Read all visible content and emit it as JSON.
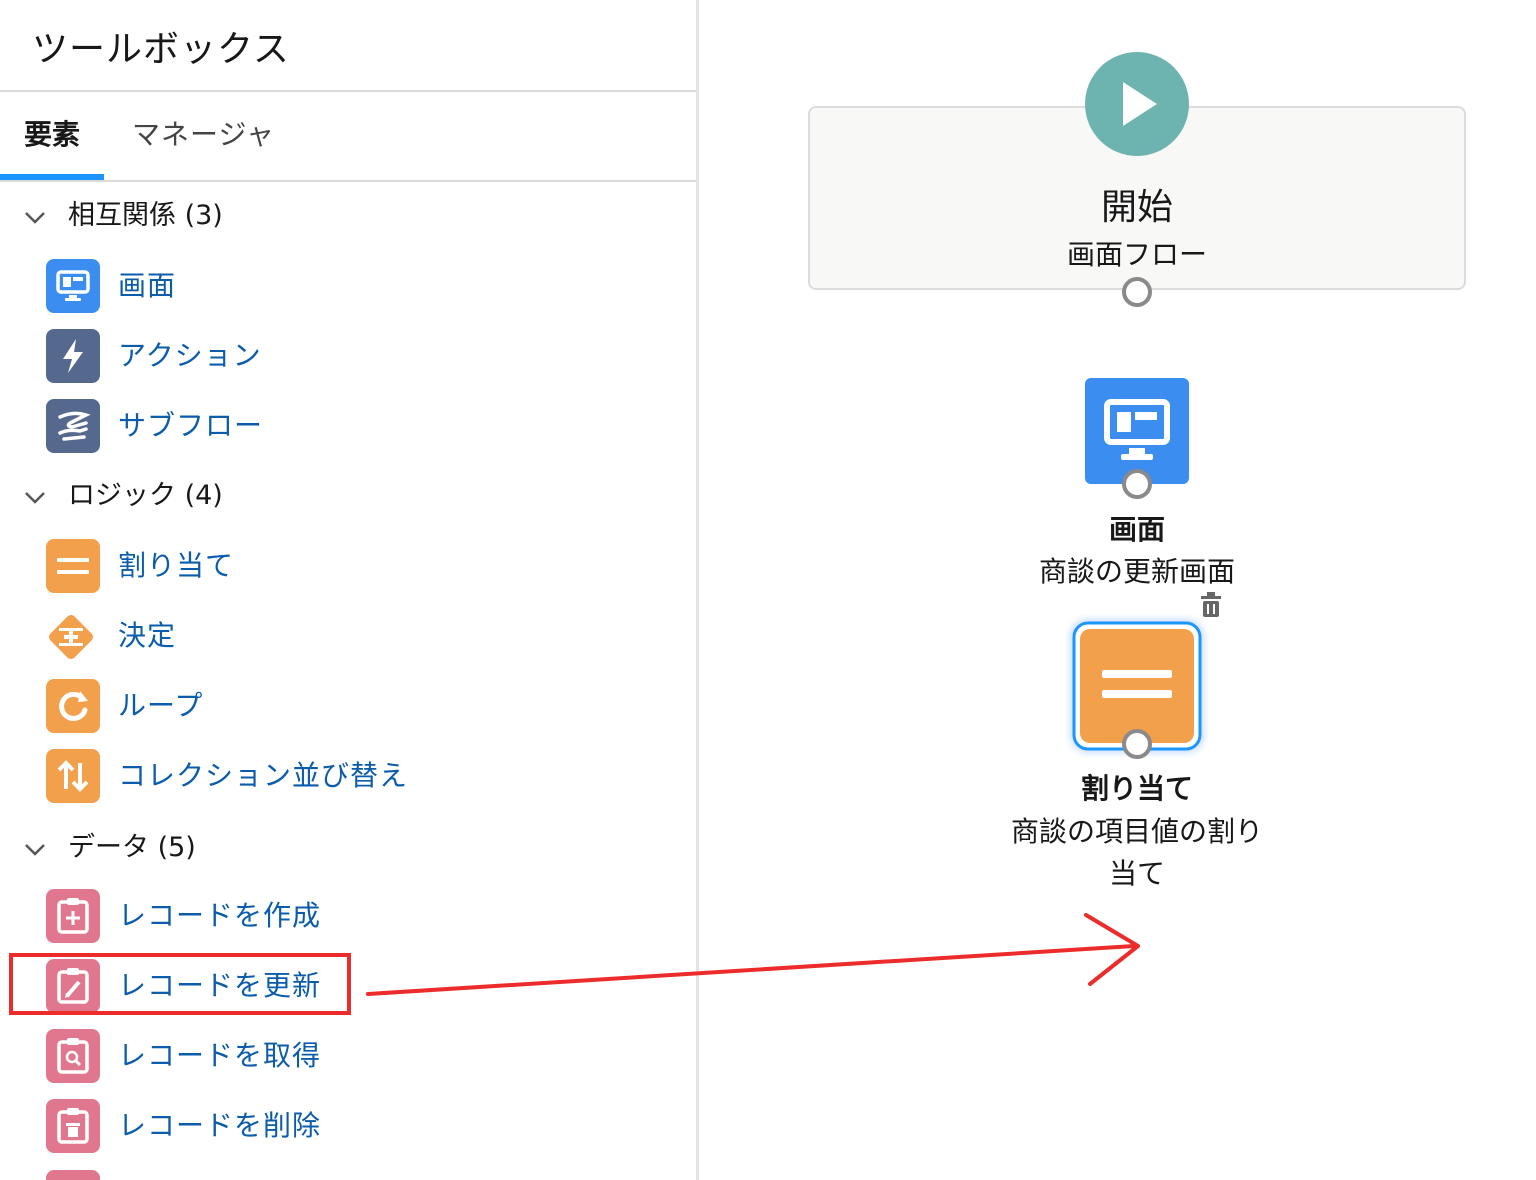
{
  "sidebar": {
    "title": "ツールボックス",
    "tabs": [
      {
        "label": "要素",
        "active": true
      },
      {
        "label": "マネージャ",
        "active": false
      }
    ],
    "sections": [
      {
        "header": "相互関係 (3)",
        "items": [
          {
            "label": "画面",
            "icon": "screen-icon",
            "color": "#3b8ef0"
          },
          {
            "label": "アクション",
            "icon": "lightning-icon",
            "color": "#54698d"
          },
          {
            "label": "サブフロー",
            "icon": "subflow-icon",
            "color": "#54698d"
          }
        ]
      },
      {
        "header": "ロジック (4)",
        "items": [
          {
            "label": "割り当て",
            "icon": "assignment-icon",
            "color": "#f2a04c"
          },
          {
            "label": "決定",
            "icon": "decision-icon",
            "color": "#f2a04c"
          },
          {
            "label": "ループ",
            "icon": "loop-icon",
            "color": "#f2a04c"
          },
          {
            "label": "コレクション並び替え",
            "icon": "sort-icon",
            "color": "#f2a04c"
          }
        ]
      },
      {
        "header": "データ (5)",
        "items": [
          {
            "label": "レコードを作成",
            "icon": "record-create-icon",
            "color": "#e0778f"
          },
          {
            "label": "レコードを更新",
            "icon": "record-update-icon",
            "color": "#e0778f"
          },
          {
            "label": "レコードを取得",
            "icon": "record-get-icon",
            "color": "#e0778f"
          },
          {
            "label": "レコードを削除",
            "icon": "record-delete-icon",
            "color": "#e0778f"
          }
        ]
      }
    ]
  },
  "canvas": {
    "start": {
      "title": "開始",
      "subtitle": "画面フロー",
      "color": "#6db3b0"
    },
    "screen_node": {
      "type": "画面",
      "label": "商談の更新画面",
      "color": "#3b8ef0"
    },
    "assignment_node": {
      "type": "割り当て",
      "label_line1": "商談の項目値の割り",
      "label_line2": "当て",
      "color": "#f2a04c"
    }
  },
  "annotation": {
    "color": "#ec2b2b"
  }
}
